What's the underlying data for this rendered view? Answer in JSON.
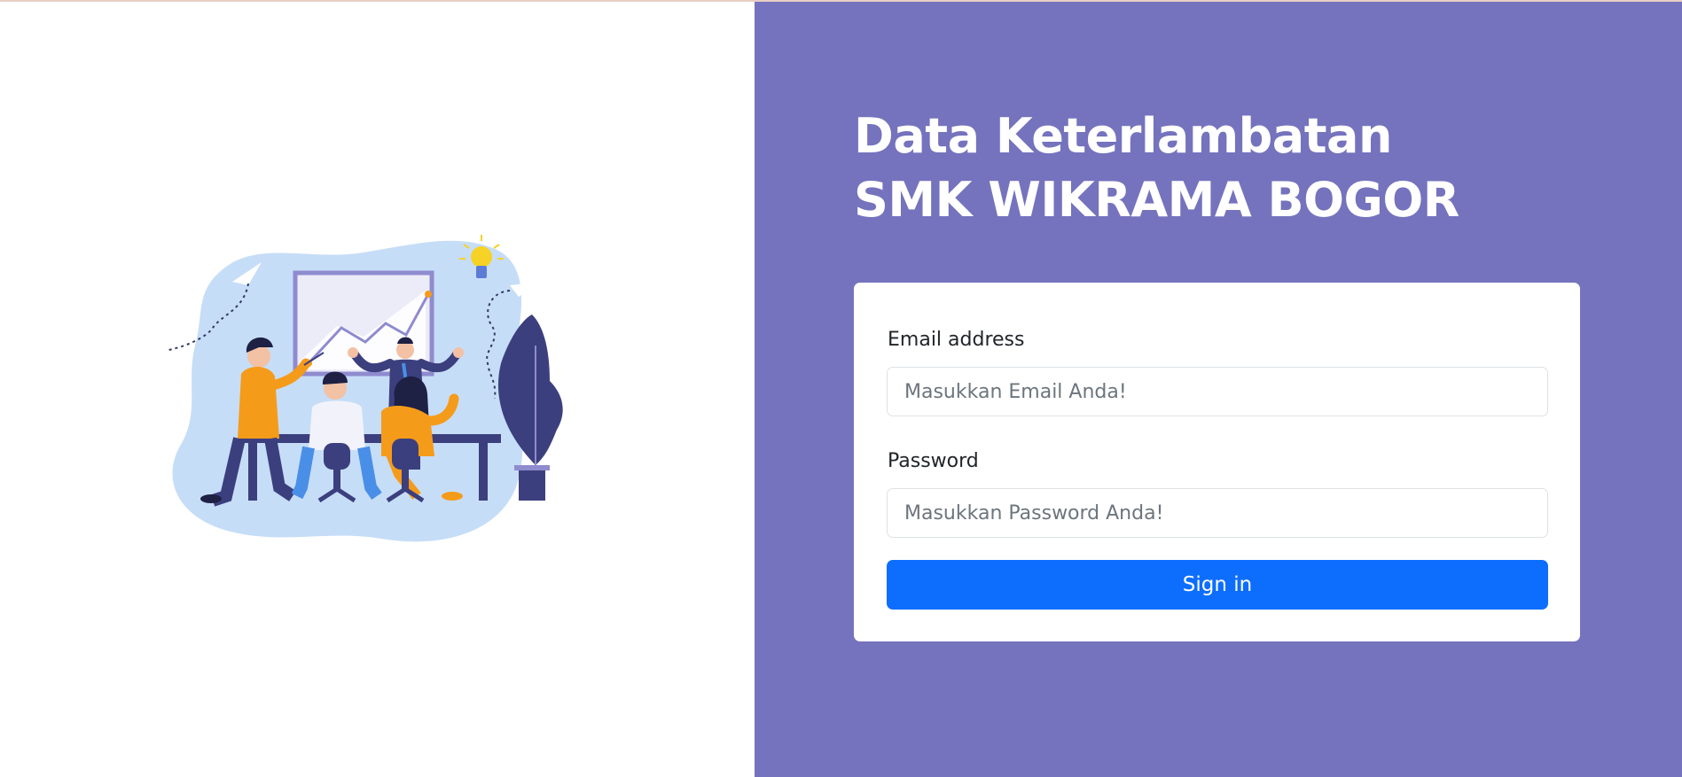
{
  "header": {
    "title_line1": "Data Keterlambatan",
    "title_line2": "SMK WIKRAMA BOGOR"
  },
  "form": {
    "email_label": "Email address",
    "email_placeholder": "Masukkan Email Anda!",
    "email_value": "",
    "password_label": "Password",
    "password_placeholder": "Masukkan Password Anda!",
    "password_value": "",
    "submit_label": "Sign in"
  },
  "illustration": {
    "icon": "team-meeting-illustration"
  },
  "colors": {
    "panel_bg": "#7573bd",
    "button_bg": "#0d6efd",
    "card_bg": "#ffffff",
    "blob_bg": "#c6ddf7",
    "figure_orange": "#f59b1a",
    "figure_navy": "#3c3f7e"
  }
}
